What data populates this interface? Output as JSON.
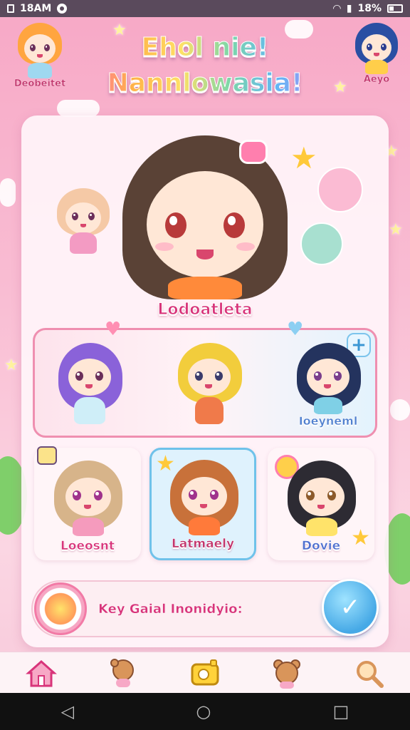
{
  "status_bar": {
    "time": "18AM",
    "battery": "18%"
  },
  "header": {
    "title_line1": "Ehol nie!",
    "title_line2": "Nannlowasia!",
    "left_character_label": "Deobeitet",
    "right_character_label": "Aeyo"
  },
  "featured": {
    "name": "Lodoatleta"
  },
  "row1": {
    "slots": [
      {
        "name": ""
      },
      {
        "name": ""
      },
      {
        "name": "Ioeyneml"
      }
    ],
    "add_label": "+"
  },
  "row2": {
    "cards": [
      {
        "name": "Loeosnt",
        "selected": false
      },
      {
        "name": "Latmaely",
        "selected": true
      },
      {
        "name": "Dovie",
        "selected": false
      }
    ]
  },
  "status_strip": {
    "text": "Key Gaial Inonidyio:"
  },
  "bottom_nav": {
    "items": [
      {
        "icon": "home-icon"
      },
      {
        "icon": "bear-icon"
      },
      {
        "icon": "camera-icon"
      },
      {
        "icon": "bear-face-icon"
      },
      {
        "icon": "search-icon"
      }
    ]
  },
  "colors": {
    "accent_pink": "#d8347a",
    "accent_blue": "#4f7fcf",
    "panel_bg": "#fff5fa"
  }
}
